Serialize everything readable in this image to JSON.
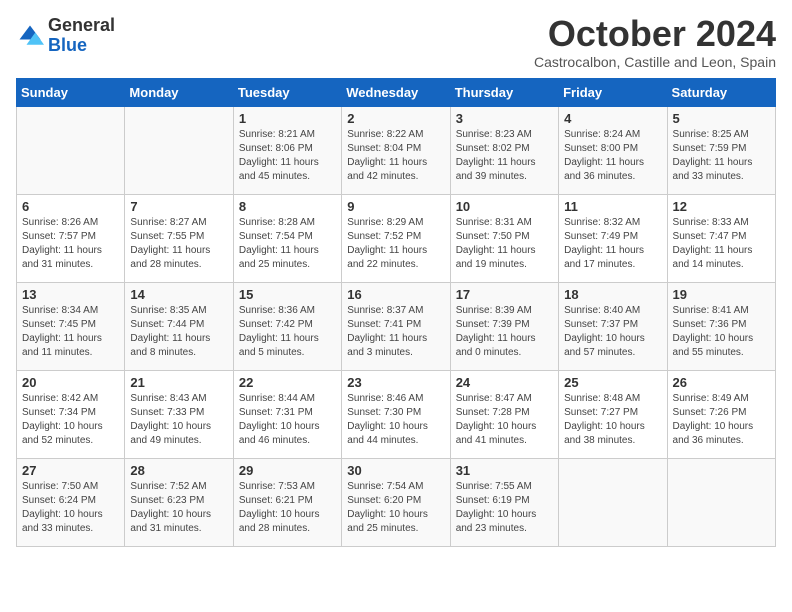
{
  "header": {
    "logo_general": "General",
    "logo_blue": "Blue",
    "month_title": "October 2024",
    "subtitle": "Castrocalbon, Castille and Leon, Spain"
  },
  "days_of_week": [
    "Sunday",
    "Monday",
    "Tuesday",
    "Wednesday",
    "Thursday",
    "Friday",
    "Saturday"
  ],
  "weeks": [
    [
      {
        "day": "",
        "text": ""
      },
      {
        "day": "",
        "text": ""
      },
      {
        "day": "1",
        "text": "Sunrise: 8:21 AM\nSunset: 8:06 PM\nDaylight: 11 hours and 45 minutes."
      },
      {
        "day": "2",
        "text": "Sunrise: 8:22 AM\nSunset: 8:04 PM\nDaylight: 11 hours and 42 minutes."
      },
      {
        "day": "3",
        "text": "Sunrise: 8:23 AM\nSunset: 8:02 PM\nDaylight: 11 hours and 39 minutes."
      },
      {
        "day": "4",
        "text": "Sunrise: 8:24 AM\nSunset: 8:00 PM\nDaylight: 11 hours and 36 minutes."
      },
      {
        "day": "5",
        "text": "Sunrise: 8:25 AM\nSunset: 7:59 PM\nDaylight: 11 hours and 33 minutes."
      }
    ],
    [
      {
        "day": "6",
        "text": "Sunrise: 8:26 AM\nSunset: 7:57 PM\nDaylight: 11 hours and 31 minutes."
      },
      {
        "day": "7",
        "text": "Sunrise: 8:27 AM\nSunset: 7:55 PM\nDaylight: 11 hours and 28 minutes."
      },
      {
        "day": "8",
        "text": "Sunrise: 8:28 AM\nSunset: 7:54 PM\nDaylight: 11 hours and 25 minutes."
      },
      {
        "day": "9",
        "text": "Sunrise: 8:29 AM\nSunset: 7:52 PM\nDaylight: 11 hours and 22 minutes."
      },
      {
        "day": "10",
        "text": "Sunrise: 8:31 AM\nSunset: 7:50 PM\nDaylight: 11 hours and 19 minutes."
      },
      {
        "day": "11",
        "text": "Sunrise: 8:32 AM\nSunset: 7:49 PM\nDaylight: 11 hours and 17 minutes."
      },
      {
        "day": "12",
        "text": "Sunrise: 8:33 AM\nSunset: 7:47 PM\nDaylight: 11 hours and 14 minutes."
      }
    ],
    [
      {
        "day": "13",
        "text": "Sunrise: 8:34 AM\nSunset: 7:45 PM\nDaylight: 11 hours and 11 minutes."
      },
      {
        "day": "14",
        "text": "Sunrise: 8:35 AM\nSunset: 7:44 PM\nDaylight: 11 hours and 8 minutes."
      },
      {
        "day": "15",
        "text": "Sunrise: 8:36 AM\nSunset: 7:42 PM\nDaylight: 11 hours and 5 minutes."
      },
      {
        "day": "16",
        "text": "Sunrise: 8:37 AM\nSunset: 7:41 PM\nDaylight: 11 hours and 3 minutes."
      },
      {
        "day": "17",
        "text": "Sunrise: 8:39 AM\nSunset: 7:39 PM\nDaylight: 11 hours and 0 minutes."
      },
      {
        "day": "18",
        "text": "Sunrise: 8:40 AM\nSunset: 7:37 PM\nDaylight: 10 hours and 57 minutes."
      },
      {
        "day": "19",
        "text": "Sunrise: 8:41 AM\nSunset: 7:36 PM\nDaylight: 10 hours and 55 minutes."
      }
    ],
    [
      {
        "day": "20",
        "text": "Sunrise: 8:42 AM\nSunset: 7:34 PM\nDaylight: 10 hours and 52 minutes."
      },
      {
        "day": "21",
        "text": "Sunrise: 8:43 AM\nSunset: 7:33 PM\nDaylight: 10 hours and 49 minutes."
      },
      {
        "day": "22",
        "text": "Sunrise: 8:44 AM\nSunset: 7:31 PM\nDaylight: 10 hours and 46 minutes."
      },
      {
        "day": "23",
        "text": "Sunrise: 8:46 AM\nSunset: 7:30 PM\nDaylight: 10 hours and 44 minutes."
      },
      {
        "day": "24",
        "text": "Sunrise: 8:47 AM\nSunset: 7:28 PM\nDaylight: 10 hours and 41 minutes."
      },
      {
        "day": "25",
        "text": "Sunrise: 8:48 AM\nSunset: 7:27 PM\nDaylight: 10 hours and 38 minutes."
      },
      {
        "day": "26",
        "text": "Sunrise: 8:49 AM\nSunset: 7:26 PM\nDaylight: 10 hours and 36 minutes."
      }
    ],
    [
      {
        "day": "27",
        "text": "Sunrise: 7:50 AM\nSunset: 6:24 PM\nDaylight: 10 hours and 33 minutes."
      },
      {
        "day": "28",
        "text": "Sunrise: 7:52 AM\nSunset: 6:23 PM\nDaylight: 10 hours and 31 minutes."
      },
      {
        "day": "29",
        "text": "Sunrise: 7:53 AM\nSunset: 6:21 PM\nDaylight: 10 hours and 28 minutes."
      },
      {
        "day": "30",
        "text": "Sunrise: 7:54 AM\nSunset: 6:20 PM\nDaylight: 10 hours and 25 minutes."
      },
      {
        "day": "31",
        "text": "Sunrise: 7:55 AM\nSunset: 6:19 PM\nDaylight: 10 hours and 23 minutes."
      },
      {
        "day": "",
        "text": ""
      },
      {
        "day": "",
        "text": ""
      }
    ]
  ]
}
